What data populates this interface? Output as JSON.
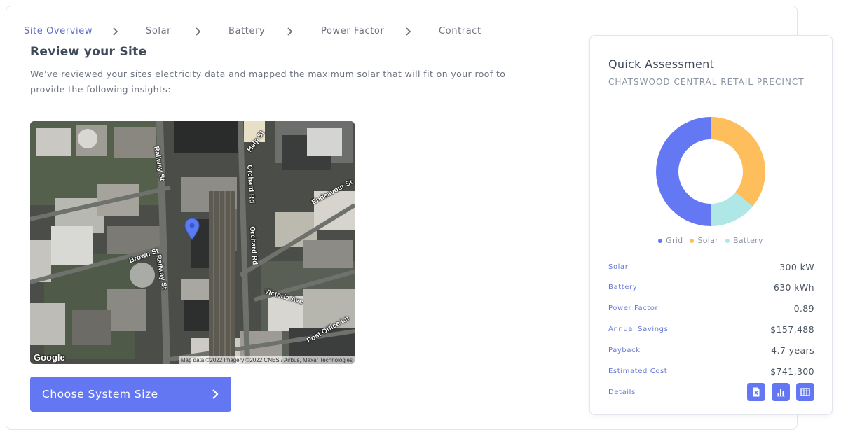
{
  "stepper": {
    "steps": [
      "Site Overview",
      "Solar",
      "Battery",
      "Power Factor",
      "Contract"
    ],
    "active_index": 0
  },
  "review": {
    "title": "Review your Site",
    "description": "We've reviewed your sites electricity data and mapped the maximum solar that will fit on your roof to provide the following insights:"
  },
  "map": {
    "streets": [
      "Railway St",
      "Railway St",
      "Help St",
      "Orchard Rd",
      "Orchard Rd",
      "Endeavour St",
      "Brown St",
      "Victoria Ave",
      "Post Office Ln"
    ],
    "logo": "Google",
    "attribution": "Map data ©2022 Imagery ©2022 CNES / Airbus, Maxar Technologies"
  },
  "cta": {
    "label": "Choose System Size"
  },
  "assessment": {
    "title": "Quick Assessment",
    "site_name": "CHATSWOOD CENTRAL RETAIL PRECINCT",
    "legend": [
      "Grid",
      "Solar",
      "Battery"
    ],
    "stats": [
      {
        "label": "Solar",
        "value": "300 kW"
      },
      {
        "label": "Battery",
        "value": "630 kWh"
      },
      {
        "label": "Power Factor",
        "value": "0.89"
      },
      {
        "label": "Annual Savings",
        "value": "$157,488"
      },
      {
        "label": "Payback",
        "value": "4.7 years"
      },
      {
        "label": "Estimated Cost",
        "value": "$741,300"
      }
    ],
    "details_label": "Details",
    "detail_icons": [
      "excel-file-icon",
      "bar-chart-icon",
      "table-icon"
    ]
  },
  "chart_data": {
    "type": "pie",
    "categories": [
      "Grid",
      "Solar",
      "Battery"
    ],
    "values": [
      50,
      36,
      14
    ],
    "colors": [
      "#6478f4",
      "#fdbe5b",
      "#aee7e6"
    ],
    "legend_position": "bottom"
  },
  "colors": {
    "accent": "#6477f2",
    "active_step": "#5b6cc9",
    "stat_label": "#6677d6"
  }
}
